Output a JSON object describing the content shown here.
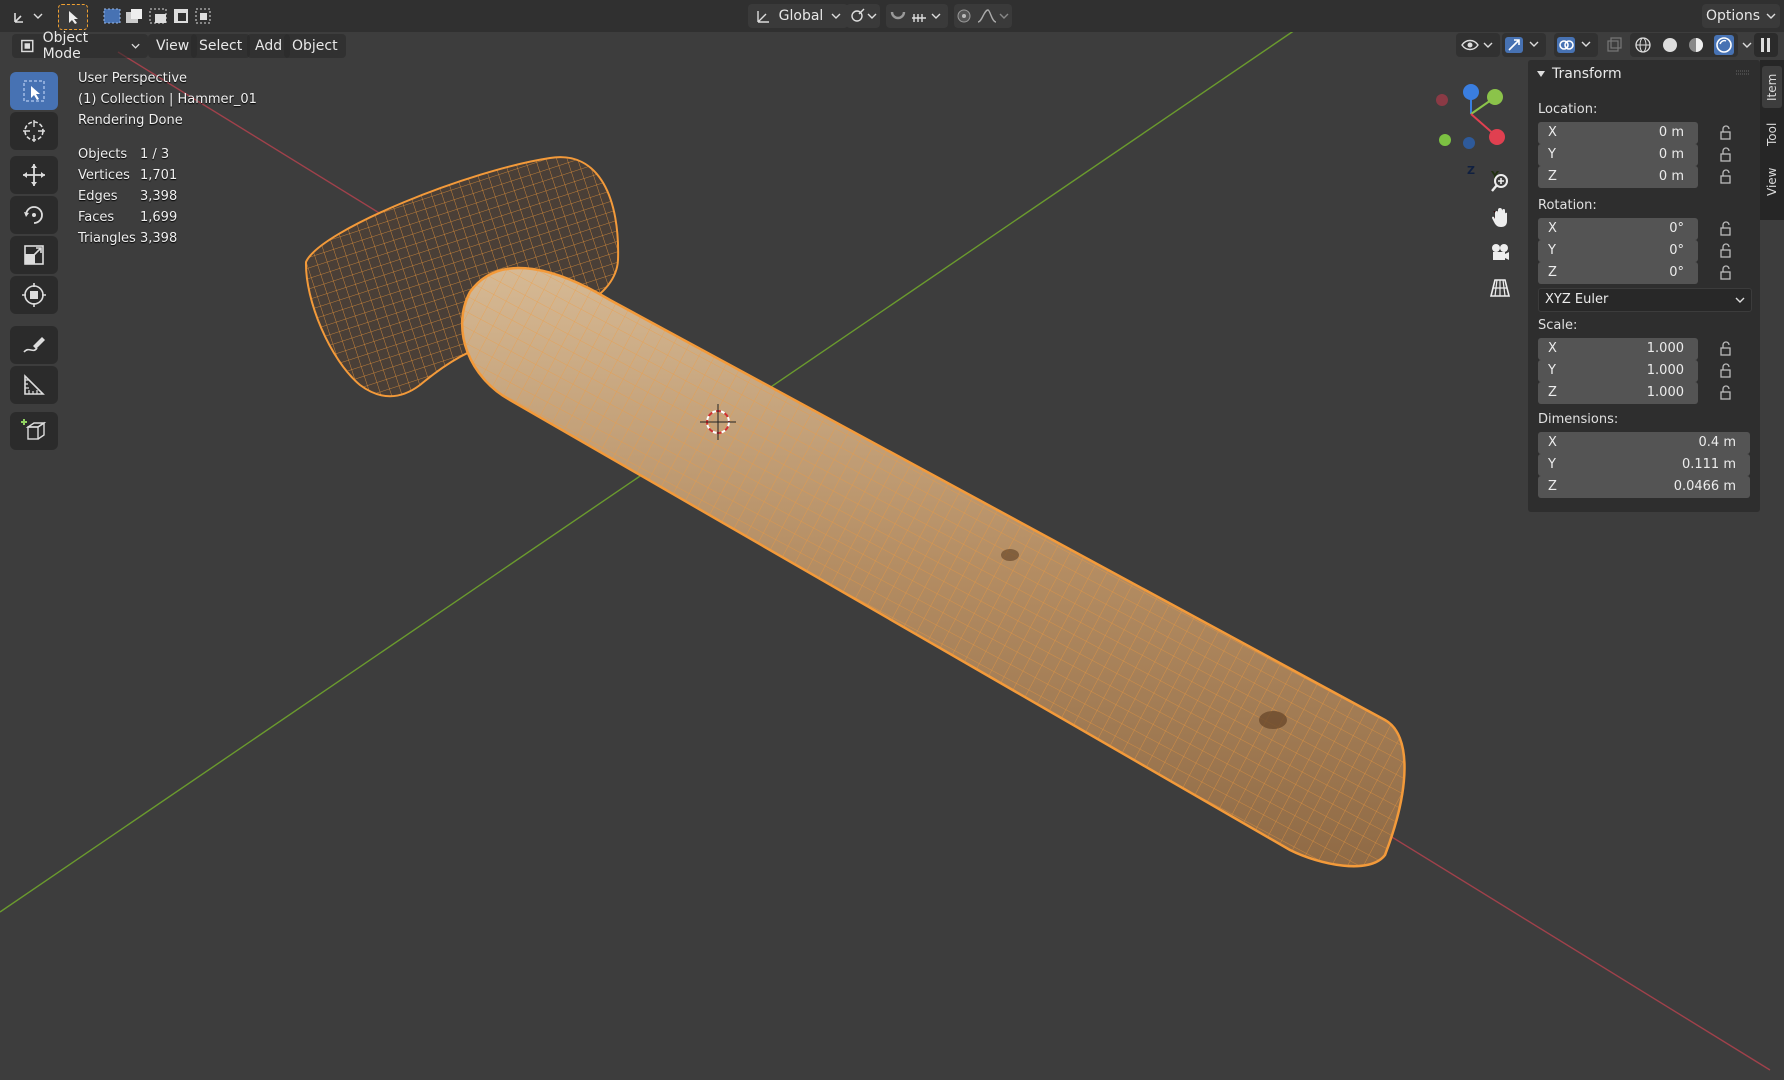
{
  "header": {
    "transform_orientation": "Global",
    "options_label": "Options"
  },
  "menus": {
    "mode": "Object Mode",
    "view": "View",
    "select": "Select",
    "add": "Add",
    "object": "Object"
  },
  "viewport": {
    "perspective": "User Perspective",
    "collection": "(1) Collection | Hammer_01",
    "status": "Rendering Done",
    "stats": [
      {
        "label": "Objects",
        "value": "1 / 3"
      },
      {
        "label": "Vertices",
        "value": "1,701"
      },
      {
        "label": "Edges",
        "value": "3,398"
      },
      {
        "label": "Faces",
        "value": "1,699"
      },
      {
        "label": "Triangles",
        "value": "3,398"
      }
    ],
    "gizmo": {
      "x": "X",
      "y": "Y",
      "z": "Z"
    }
  },
  "panel": {
    "title": "Transform",
    "location_label": "Location:",
    "location": [
      {
        "axis": "X",
        "value": "0 m"
      },
      {
        "axis": "Y",
        "value": "0 m"
      },
      {
        "axis": "Z",
        "value": "0 m"
      }
    ],
    "rotation_label": "Rotation:",
    "rotation": [
      {
        "axis": "X",
        "value": "0°"
      },
      {
        "axis": "Y",
        "value": "0°"
      },
      {
        "axis": "Z",
        "value": "0°"
      }
    ],
    "rotation_mode": "XYZ Euler",
    "scale_label": "Scale:",
    "scale": [
      {
        "axis": "X",
        "value": "1.000"
      },
      {
        "axis": "Y",
        "value": "1.000"
      },
      {
        "axis": "Z",
        "value": "1.000"
      }
    ],
    "dimensions_label": "Dimensions:",
    "dimensions": [
      {
        "axis": "X",
        "value": "0.4 m"
      },
      {
        "axis": "Y",
        "value": "0.111 m"
      },
      {
        "axis": "Z",
        "value": "0.0466 m"
      }
    ]
  },
  "side_tabs": {
    "item": "Item",
    "tool": "Tool",
    "view": "View"
  },
  "colors": {
    "x_axis": "#a0414b",
    "y_axis": "#6a9a2e",
    "selection": "#f59a2e",
    "active_tool": "#4772b3",
    "wood": "#b9926a"
  }
}
